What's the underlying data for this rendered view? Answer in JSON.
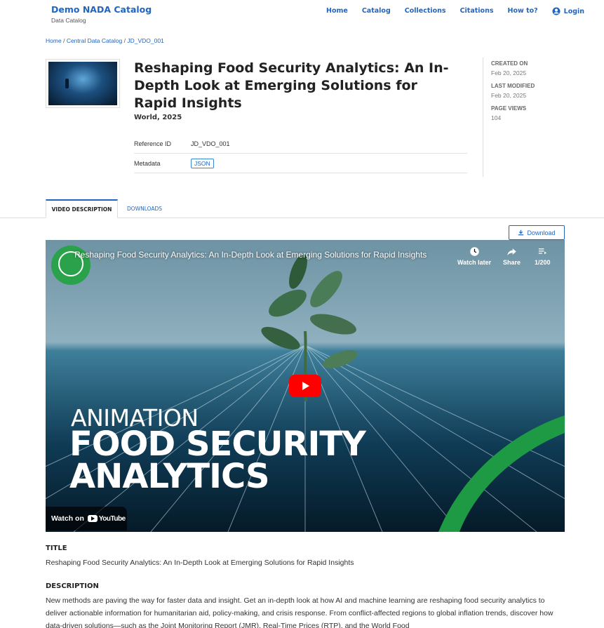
{
  "header": {
    "brand_title": "Demo NADA Catalog",
    "brand_subtitle": "Data Catalog",
    "nav": [
      "Home",
      "Catalog",
      "Collections",
      "Citations",
      "How to?"
    ],
    "login_label": "Login"
  },
  "breadcrumb": {
    "items": [
      "Home",
      "Central Data Catalog",
      "JD_VDO_001"
    ],
    "separator": "/"
  },
  "study": {
    "title": "Reshaping Food Security Analytics: An In-Depth Look at Emerging Solutions for Rapid Insights",
    "subtitle": "World, 2025",
    "reference_id_label": "Reference ID",
    "reference_id": "JD_VDO_001",
    "metadata_label": "Metadata",
    "metadata_badge": "JSON"
  },
  "stats": {
    "created_label": "CREATED ON",
    "created_value": "Feb 20, 2025",
    "modified_label": "LAST MODIFIED",
    "modified_value": "Feb 20, 2025",
    "views_label": "PAGE VIEWS",
    "views_value": "104"
  },
  "tabs": {
    "active": "VIDEO DESCRIPTION",
    "inactive": "DOWNLOADS"
  },
  "download_button": "Download",
  "video": {
    "title": "Reshaping Food Security Analytics: An In-Depth Look at Emerging Solutions for Rapid Insights",
    "watch_later": "Watch later",
    "share": "Share",
    "playlist_count": "1/200",
    "overlay_line1": "ANIMATION",
    "overlay_line2": "FOOD SECURITY",
    "overlay_line3": "ANALYTICS",
    "watch_on": "Watch on",
    "youtube": "YouTube"
  },
  "content": {
    "title_label": "TITLE",
    "title_text": "Reshaping Food Security Analytics: An In-Depth Look at Emerging Solutions for Rapid Insights",
    "description_label": "DESCRIPTION",
    "description_text": "New methods are paving the way for faster data and insight. Get an in-depth look at how AI and machine learning are reshaping food security analytics to deliver actionable information for humanitarian aid, policy-making, and crisis response. From conflict-affected regions to global inflation trends, discover how data-driven solutions—such as the Joint Monitoring Report (JMR), Real-Time Prices (RTP), and the World Food"
  },
  "colors": {
    "link": "#1f66c1",
    "youtube_red": "#ff0000",
    "wb_green": "#2aa14b"
  }
}
